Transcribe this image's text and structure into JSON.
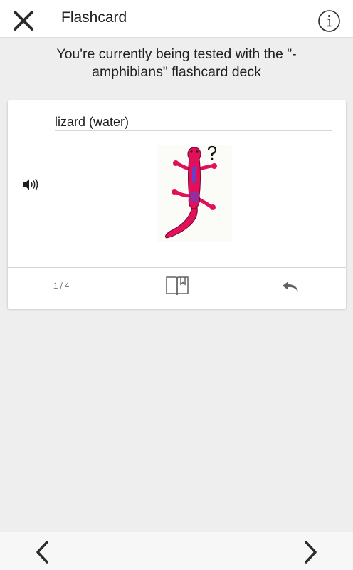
{
  "header": {
    "title": "Flashcard",
    "close_icon": "close-icon",
    "info_icon": "info-icon"
  },
  "banner": {
    "line1": "You're currently being tested with the \"-",
    "line2": "amphibians\" flashcard deck"
  },
  "card": {
    "term": "lizard (water)",
    "audio_icon": "speaker-icon",
    "image": "red-lizard-illustration",
    "counter": "1 / 4",
    "book_icon": "book-bookmark-icon",
    "undo_icon": "reply-arrow-icon"
  },
  "footer": {
    "prev_icon": "chevron-left-icon",
    "next_icon": "chevron-right-icon"
  },
  "colors": {
    "app_background": "#eeeeee",
    "surface": "#ffffff",
    "lizard_body": "#e0105a",
    "lizard_marks": "#6a3fc4",
    "icon_gray": "#616161"
  }
}
